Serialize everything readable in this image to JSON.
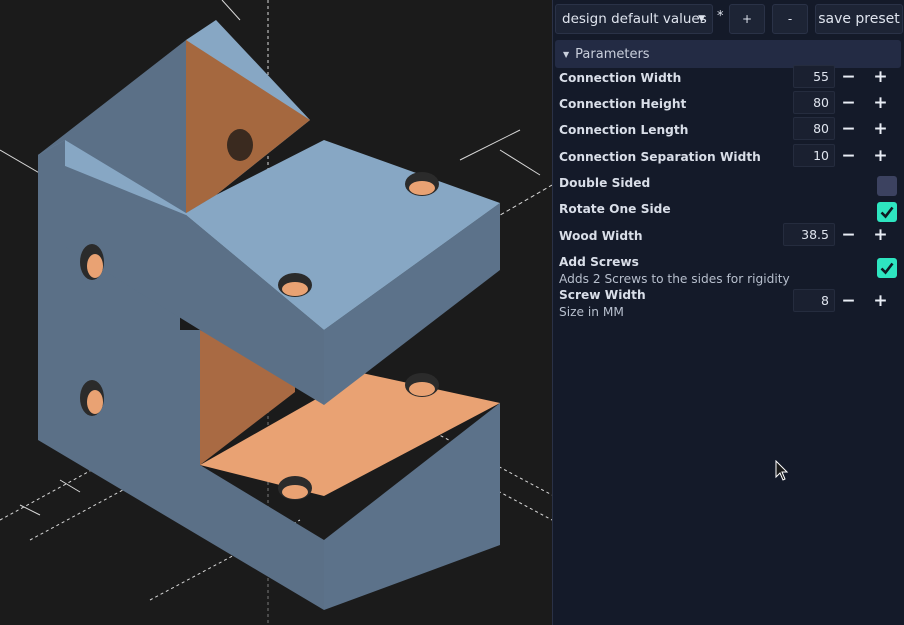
{
  "toolbar": {
    "preset_value": "design default values",
    "modified_mark": "*",
    "add_label": "+",
    "remove_label": "-",
    "save_label": "save preset"
  },
  "section": {
    "title": "Parameters",
    "expanded": true
  },
  "params": [
    {
      "label": "Connection Width",
      "value": "55",
      "type": "number"
    },
    {
      "label": "Connection Height",
      "value": "80",
      "type": "number"
    },
    {
      "label": "Connection Length",
      "value": "80",
      "type": "number"
    },
    {
      "label": "Connection Separation Width",
      "value": "10",
      "type": "number"
    },
    {
      "label": "Double Sided",
      "checked": false,
      "type": "checkbox"
    },
    {
      "label": "Rotate One Side",
      "checked": true,
      "type": "checkbox"
    },
    {
      "label": "Wood Width",
      "value": "38.5",
      "type": "number"
    },
    {
      "label": "Add Screws",
      "description": "Adds 2 Screws to the sides for rigidity",
      "checked": true,
      "type": "checkbox"
    },
    {
      "label": "Screw Width",
      "description": "Size in MM",
      "value": "8",
      "type": "number"
    }
  ],
  "stepper": {
    "decrement": "−",
    "increment": "+"
  },
  "icons": {
    "dropdown": "chevron-down-icon",
    "collapse": "triangle-down-icon",
    "check": "check-icon",
    "cursor": "mouse-cursor-icon"
  },
  "colors": {
    "panel_bg": "#141a29",
    "section_bg": "#232b44",
    "accent": "#2ee5c0",
    "model_blue": "#87a7c4",
    "model_orange": "#e7a06f"
  }
}
